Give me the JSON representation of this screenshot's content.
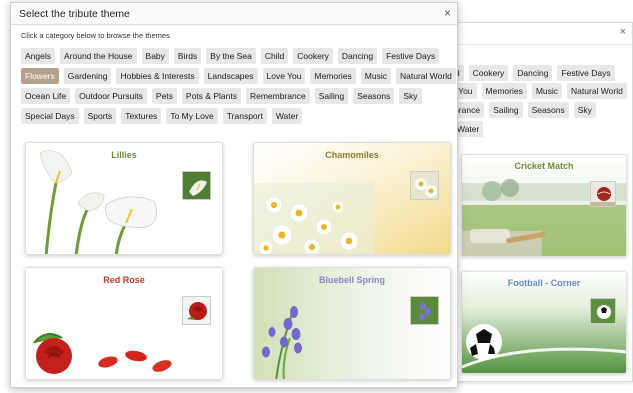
{
  "dialog": {
    "title": "Select the tribute theme",
    "close_label": "×",
    "instruction": "Click a category below to browse the themes"
  },
  "categories": [
    [
      "Angels",
      "Around the House",
      "Baby",
      "Birds",
      "By the Sea",
      "Child",
      "Cookery",
      "Dancing",
      "Festive Days"
    ],
    [
      "Flowers",
      "Gardening",
      "Hobbies & Interests",
      "Landscapes",
      "Love You",
      "Memories",
      "Music",
      "Natural World"
    ],
    [
      "Ocean Life",
      "Outdoor Pursuits",
      "Pets",
      "Pots & Plants",
      "Remembrance",
      "Sailing",
      "Seasons",
      "Sky"
    ],
    [
      "Special Days",
      "Sports",
      "Textures",
      "To My Love",
      "Transport",
      "Water"
    ]
  ],
  "active_category": "Flowers",
  "themes": [
    {
      "title": "Lillies",
      "title_color": "#6e8a3a"
    },
    {
      "title": "Chamomiles",
      "title_color": "#8a7a2a"
    },
    {
      "title": "Red Rose",
      "title_color": "#c0392b"
    },
    {
      "title": "Bluebell Spring",
      "title_color": "#8a84c8"
    }
  ],
  "background_dialog": {
    "close_label": "×",
    "category_rows": [
      [
        "ld",
        "Cookery",
        "Dancing",
        "Festive Days"
      ],
      [
        "ve You",
        "Memories",
        "Music",
        "Natural World"
      ],
      [
        "mbrance",
        "Sailing",
        "Seasons",
        "Sky"
      ],
      [
        "Water"
      ]
    ],
    "themes": [
      {
        "title": "Cricket Match",
        "title_color": "#6e8a3a"
      },
      {
        "title": "Football - Corner",
        "title_color": "#6a8fbf"
      }
    ]
  },
  "colors": {
    "active_category_bg": "#b5a28a",
    "category_bg": "#e7e7e7"
  }
}
